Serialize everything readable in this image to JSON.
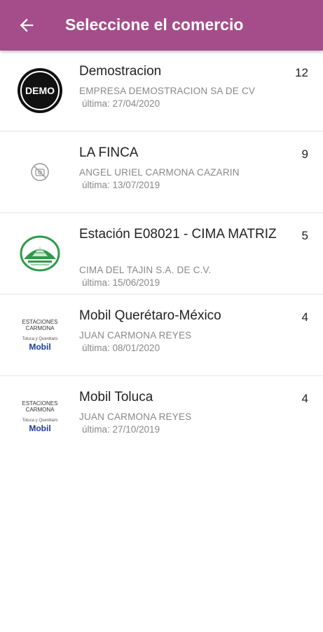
{
  "header": {
    "title": "Seleccione el comercio",
    "back_icon": "arrow-left-icon",
    "bg_color": "#a54d8a"
  },
  "merchants": [
    {
      "name": "Demostracion",
      "owner": "EMPRESA DEMOSTRACION SA DE CV",
      "date": "última: 27/04/2020",
      "count": "12",
      "logo_text": "DEMO"
    },
    {
      "name": "LA FINCA",
      "owner": "ANGEL URIEL CARMONA CAZARIN",
      "date": "última: 13/07/2019",
      "count": "9",
      "logo_text": ""
    },
    {
      "name": "Estación E08021 - CIMA MATRIZ",
      "owner": "CIMA DEL TAJIN S.A. DE C.V.",
      "date": "última: 15/06/2019",
      "count": "5",
      "logo_text": ""
    },
    {
      "name": "Mobil Querétaro-México",
      "owner": "JUAN CARMONA REYES",
      "date": "última: 08/01/2020",
      "count": "4",
      "logo_text": "ESTACIONES CARMONA",
      "logo_sub": "Toluca y Querétaro",
      "logo_brand": "Mobil"
    },
    {
      "name": "Mobil Toluca",
      "owner": "JUAN CARMONA REYES",
      "date": "última: 27/10/2019",
      "count": "4",
      "logo_text": "ESTACIONES CARMONA",
      "logo_sub": "Toluca y Querétaro",
      "logo_brand": "Mobil"
    }
  ]
}
